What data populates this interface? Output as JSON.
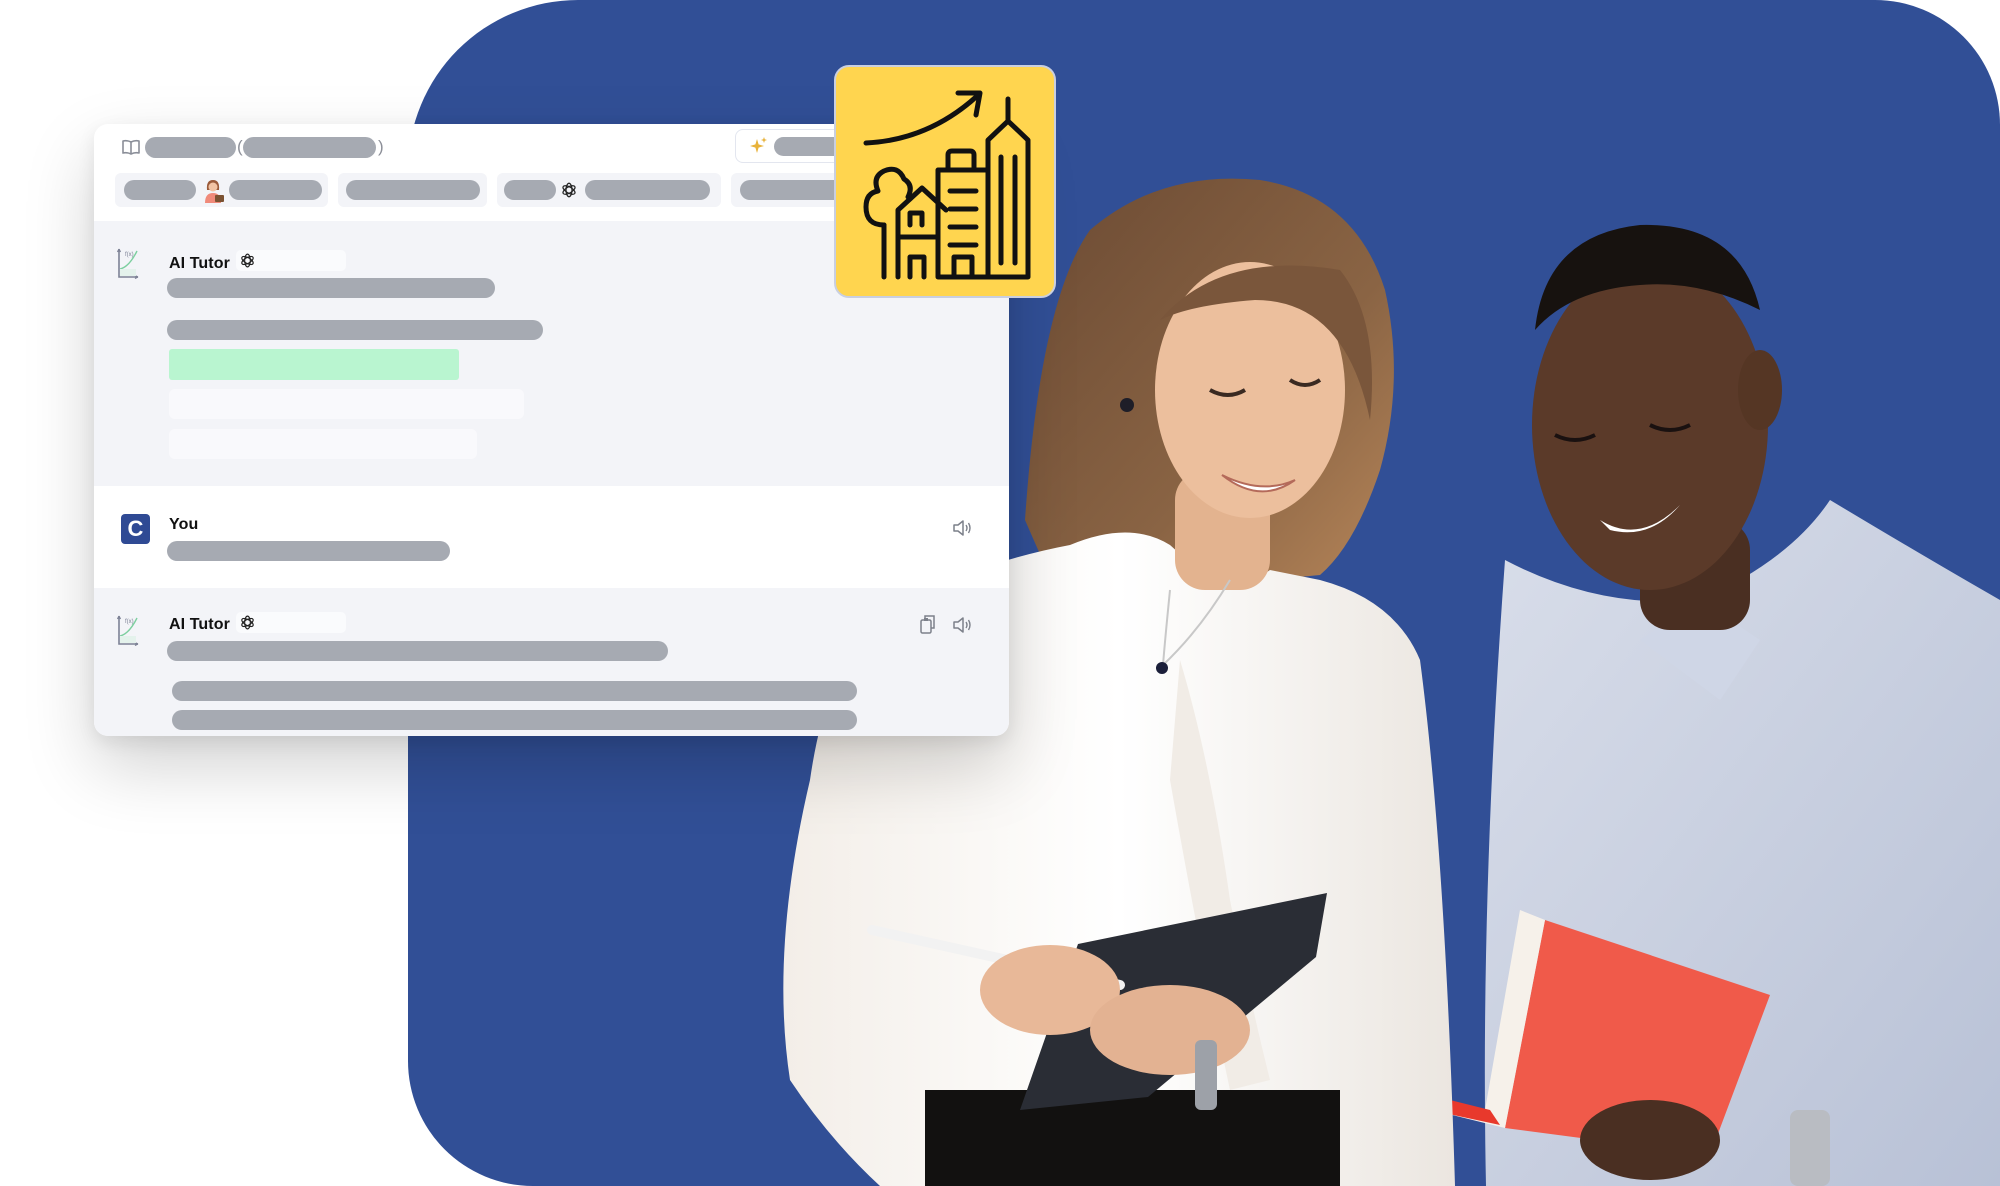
{
  "colors": {
    "brand_blue": "#314f96",
    "placeholder_gray": "#a6aab2",
    "section_gray": "#f3f4f8",
    "highlight_green": "#b9f5d0",
    "yellow_badge": "#ffd54f",
    "sparkle_gold": "#e8b23a"
  },
  "header": {
    "icon": "book-open-icon",
    "title_open_paren": "(",
    "title_close_paren": ")",
    "ai_button_icon": "sparkles-icon"
  },
  "tabs": [
    {
      "icon": "persona-avatar-icon"
    },
    {
      "icon": null
    },
    {
      "icon": "openai-logo-icon"
    },
    {
      "icon": null
    }
  ],
  "messages": [
    {
      "sender": "AI Tutor",
      "avatar": "function-graph-icon",
      "model_icon": "openai-logo-icon",
      "actions": []
    },
    {
      "sender": "You",
      "avatar": "C",
      "actions": [
        "speaker-icon"
      ]
    },
    {
      "sender": "AI Tutor",
      "avatar": "function-graph-icon",
      "model_icon": "openai-logo-icon",
      "actions": [
        "copy-icon",
        "speaker-icon"
      ]
    }
  ],
  "avatar_function_label": "f(x)",
  "badge": {
    "icon": "city-growth-icon"
  },
  "photo": {
    "subject": "two-people-reviewing-notes"
  }
}
